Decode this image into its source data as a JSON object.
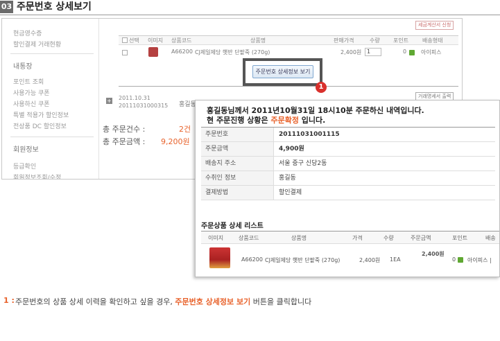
{
  "header": {
    "section_number": "03",
    "title": "주문번호 상세보기"
  },
  "sidebar": {
    "items_top": [
      "현금영수증",
      "할인결제 거래현황"
    ],
    "group2_title": "내통장",
    "group2_items": [
      "포인트 조회",
      "사용가능 쿠폰",
      "사용하신 쿠폰",
      "특별 적용가 할인정보",
      "전상품 DC 할인정보"
    ],
    "group3_title": "회원정보",
    "group3_items": [
      "등급확인",
      "회원정보조회/수정"
    ]
  },
  "summary": {
    "count_label": "총 주문건수 :",
    "count_value": "2건",
    "amount_label": "총 주문금액 :",
    "amount_value": "9,200원"
  },
  "order_table": {
    "headers": [
      "선택",
      "이미지",
      "상품코드",
      "상품명",
      "판매가격",
      "수량",
      "포인트",
      "배송형태"
    ],
    "row": {
      "code": "A66200",
      "name": "CJ제일제당 햇반 단팥죽 (270g)",
      "price": "2,400원",
      "qty": "1",
      "point": "0",
      "delivery": "아이피스"
    },
    "tax_button": "세금계산서 신청",
    "statement_button": "거래명세서 출력",
    "order_date": "2011.10.31",
    "order_no": "20111031000315",
    "order_name": "홍길동"
  },
  "detail_button": "주문번호 상세정보 보기",
  "marker": "1",
  "popup": {
    "msg_line1": "홍길동님께서 2011년10월31일 18시10분 주문하신 내역입니다.",
    "msg_line2_prefix": "현 주문진행 상황은 ",
    "msg_line2_status": "주문확정",
    "msg_line2_suffix": " 입니다.",
    "info": [
      {
        "label": "주문번호",
        "value": "20111031001115"
      },
      {
        "label": "주문금액",
        "value": "4,900원"
      },
      {
        "label": "배송지 주소",
        "value": "서울 중구 신당2동"
      },
      {
        "label": "수취인 정보",
        "value": "홍길동"
      },
      {
        "label": "결제방법",
        "value": "할인결제"
      }
    ],
    "list_title": "주문상품 상세 리스트",
    "list_headers": [
      "이미지",
      "상품코드",
      "상품명",
      "가격",
      "수량",
      "주문금액",
      "포인트",
      "배송"
    ],
    "list_row": {
      "code": "A66200",
      "name": "CJ제일제당 햇반 단팥죽 (270g)",
      "price": "2,400원",
      "qty": "1EA",
      "amount": "2,400원",
      "point": "0",
      "delivery": "아이피스 |"
    }
  },
  "caption": {
    "num": "1 :",
    "before": "주문번호의 상품 상세 이력을 확인하고 싶을 경우, ",
    "highlight": "주문번호 상세정보 보기",
    "after": " 버튼을 클릭합니다"
  }
}
